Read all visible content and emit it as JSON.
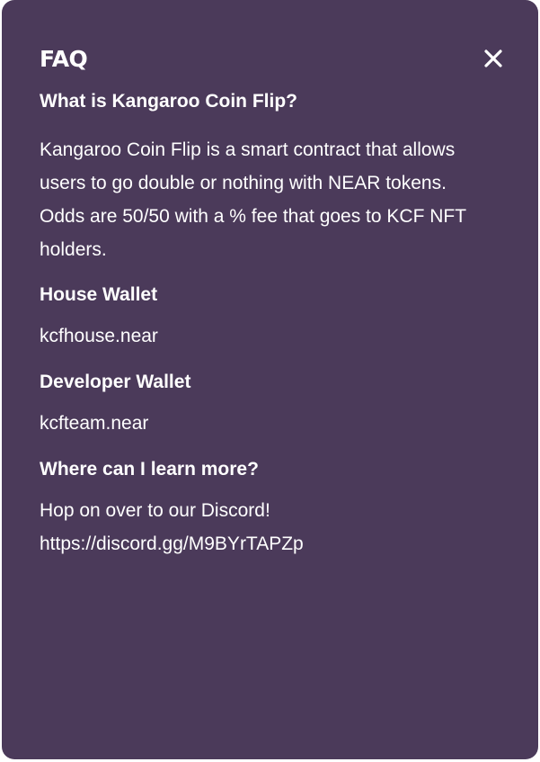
{
  "modal": {
    "title": "FAQ",
    "close_icon": "close-icon",
    "background_color": "#4b3a5a",
    "text_color": "#ffffff"
  },
  "faq": [
    {
      "question": "What is Kangaroo Coin Flip?",
      "answer": "Kangaroo Coin Flip is a smart contract that allows users to go double or nothing with NEAR tokens. Odds are 50/50 with a % fee that goes to KCF NFT holders."
    },
    {
      "question": "House Wallet",
      "answer": "kcfhouse.near"
    },
    {
      "question": "Developer Wallet",
      "answer": "kcfteam.near"
    },
    {
      "question": "Where can I learn more?",
      "answer": "Hop on over to our Discord! https://discord.gg/M9BYrTAPZp"
    }
  ]
}
